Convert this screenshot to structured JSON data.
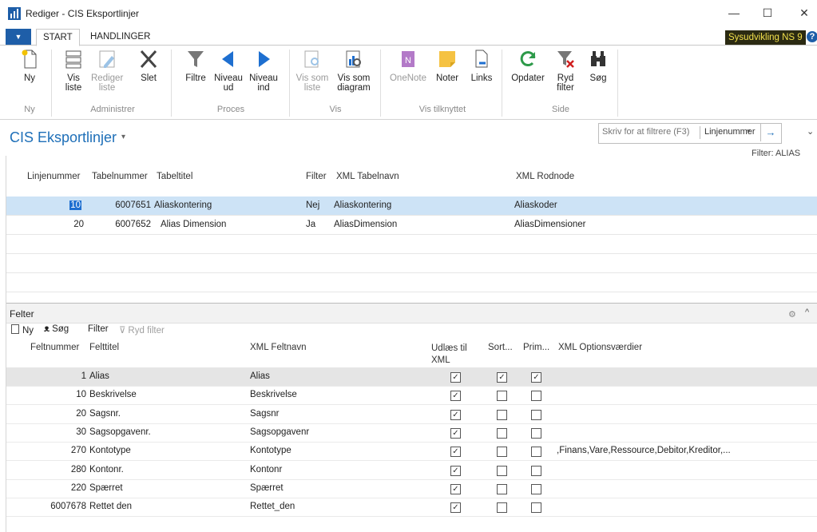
{
  "window": {
    "title": "Rediger - CIS Eksportlinjer",
    "minimize": "—",
    "maximize": "☐",
    "close": "✕"
  },
  "ribbon_tabs": {
    "file": "▼",
    "start": "START",
    "actions": "HANDLINGER"
  },
  "company": "Sysudvikling NS 9",
  "help": "?",
  "ribbon": {
    "new": {
      "line1": "Ny",
      "line2": ""
    },
    "view_list": {
      "line1": "Vis",
      "line2": "liste"
    },
    "edit_list": {
      "line1": "Rediger",
      "line2": "liste"
    },
    "delete": {
      "line1": "Slet",
      "line2": ""
    },
    "filters": {
      "line1": "Filtre",
      "line2": ""
    },
    "level_out": {
      "line1": "Niveau",
      "line2": "ud"
    },
    "level_in": {
      "line1": "Niveau",
      "line2": "ind"
    },
    "show_as_list": {
      "line1": "Vis som",
      "line2": "liste"
    },
    "show_as_chart": {
      "line1": "Vis som",
      "line2": "diagram"
    },
    "onenote": {
      "line1": "OneNote",
      "line2": ""
    },
    "notes": {
      "line1": "Noter",
      "line2": ""
    },
    "links": {
      "line1": "Links",
      "line2": ""
    },
    "refresh": {
      "line1": "Opdater",
      "line2": ""
    },
    "clear_filter": {
      "line1": "Ryd",
      "line2": "filter"
    },
    "find": {
      "line1": "Søg",
      "line2": ""
    },
    "groups": {
      "new": "Ny",
      "manage": "Administrer",
      "process": "Proces",
      "view": "Vis",
      "attached": "Vis tilknyttet",
      "page": "Side"
    }
  },
  "page": {
    "title": "CIS Eksportlinjer",
    "title_caret": "▾",
    "search_placeholder": "Skriv for at filtrere (F3)",
    "filter_field": "Linjenummer",
    "filter_dropdown": "▾",
    "filter_go": "→",
    "collapse": "⌄",
    "filter_status": "Filter: ALIAS"
  },
  "lines": {
    "headers": {
      "line_no": "Linjenummer",
      "table_no": "Tabelnummer",
      "table_title": "Tabeltitel",
      "filter": "Filter",
      "xml_table_name": "XML Tabelnavn",
      "xml_root": "XML Rodnode"
    },
    "rows": [
      {
        "line_no": "10",
        "table_no": "6007651",
        "table_title": "Aliaskontering",
        "filter": "Nej",
        "xml_table_name": "Aliaskontering",
        "xml_root": "Aliaskoder"
      },
      {
        "line_no": "20",
        "table_no": "6007652",
        "table_title": "Alias Dimension",
        "filter": "Ja",
        "xml_table_name": "AliasDimension",
        "xml_root": "AliasDimensioner"
      }
    ]
  },
  "fields": {
    "title": "Felter",
    "settings_icon": "⚙",
    "collapse_icon": "^",
    "toolbar": {
      "new": "Ny",
      "find": "Søg",
      "filter": "Filter",
      "clear_filter": "Ryd filter"
    },
    "headers": {
      "field_no": "Feltnummer",
      "field_title": "Felttitel",
      "xml_field_name": "XML Feltnavn",
      "export_line1": "Udlæs til",
      "export_line2": "XML",
      "sort": "Sort...",
      "prim": "Prim...",
      "xml_options": "XML Optionsværdier"
    },
    "rows": [
      {
        "no": "1",
        "title": "Alias",
        "xml": "Alias",
        "export": true,
        "sort": true,
        "prim": true,
        "options": ""
      },
      {
        "no": "10",
        "title": "Beskrivelse",
        "xml": "Beskrivelse",
        "export": true,
        "sort": false,
        "prim": false,
        "options": ""
      },
      {
        "no": "20",
        "title": "Sagsnr.",
        "xml": "Sagsnr",
        "export": true,
        "sort": false,
        "prim": false,
        "options": ""
      },
      {
        "no": "30",
        "title": "Sagsopgavenr.",
        "xml": "Sagsopgavenr",
        "export": true,
        "sort": false,
        "prim": false,
        "options": ""
      },
      {
        "no": "270",
        "title": "Kontotype",
        "xml": "Kontotype",
        "export": true,
        "sort": false,
        "prim": false,
        "options": ",Finans,Vare,Ressource,Debitor,Kreditor,..."
      },
      {
        "no": "280",
        "title": "Kontonr.",
        "xml": "Kontonr",
        "export": true,
        "sort": false,
        "prim": false,
        "options": ""
      },
      {
        "no": "220",
        "title": "Spærret",
        "xml": "Spærret",
        "export": true,
        "sort": false,
        "prim": false,
        "options": ""
      },
      {
        "no": "6007678",
        "title": "Rettet den",
        "xml": "Rettet_den",
        "export": true,
        "sort": false,
        "prim": false,
        "options": ""
      }
    ]
  }
}
